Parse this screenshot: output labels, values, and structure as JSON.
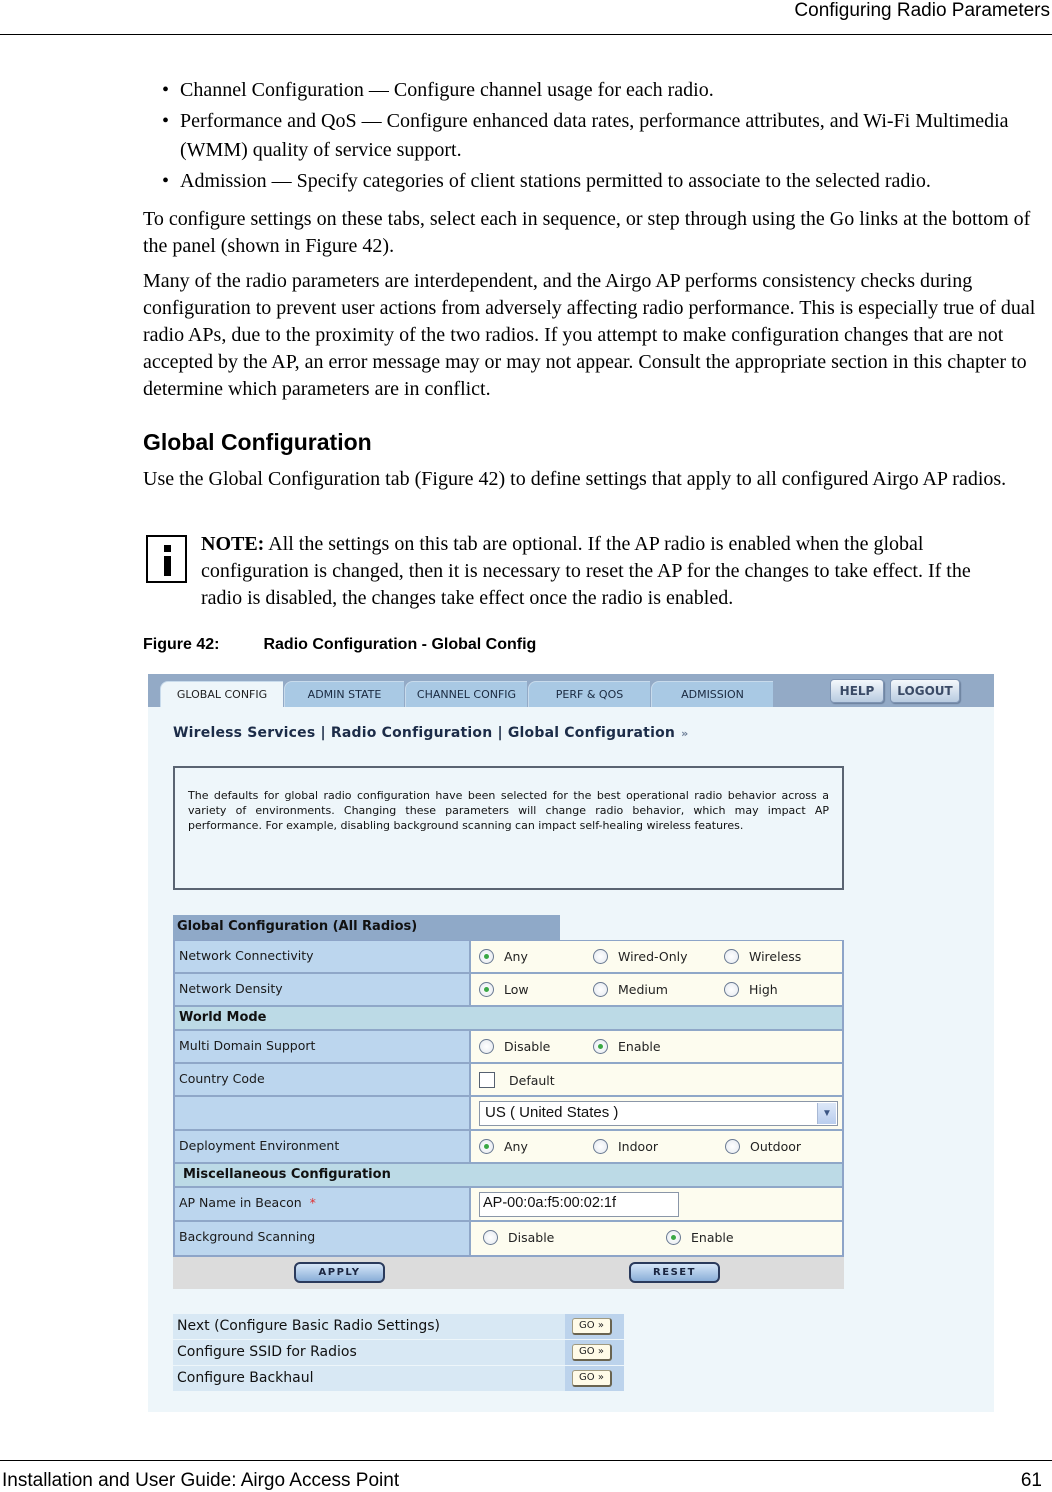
{
  "running_header": "Configuring Radio Parameters",
  "bullets": [
    "Channel Configuration — Configure channel usage for each radio.",
    "Performance and QoS — Configure enhanced data rates, performance attributes, and Wi-Fi Multimedia (WMM) quality of service support.",
    "Admission — Specify categories of client stations permitted to associate to the selected radio."
  ],
  "paragraphs": {
    "p1": "To configure settings on these tabs, select each in sequence, or step through using the Go links at the bottom of the panel (shown in Figure 42).",
    "p2": "Many of the radio parameters are interdependent, and the Airgo AP performs consistency checks during configuration to prevent user actions from adversely affecting radio performance. This is especially true of dual radio APs, due to the proximity of the two radios. If you attempt to make configuration changes that are not accepted by the AP, an error message may or may not appear. Consult the appropriate section in this chapter to determine which parameters are in conflict.",
    "section_heading": "Global Configuration",
    "p3": "Use the Global Configuration tab (Figure 42) to define settings that apply to all configured Airgo AP radios."
  },
  "note": {
    "icon": "info-icon",
    "label": "NOTE:",
    "text": " All the settings on this tab are optional. If the AP radio is enabled when the global configuration is changed, then it is necessary to reset the AP for the changes to take effect. If the radio is disabled, the changes take effect once the radio is enabled."
  },
  "figure": {
    "number": "Figure 42:",
    "title": "Radio Configuration - Global Config"
  },
  "ui": {
    "tabs": [
      {
        "label": "GLOBAL CONFIG",
        "active": true
      },
      {
        "label": "ADMIN STATE",
        "active": false
      },
      {
        "label": "CHANNEL CONFIG",
        "active": false
      },
      {
        "label": "PERF & QOS",
        "active": false
      },
      {
        "label": "ADMISSION",
        "active": false
      }
    ],
    "help_label": "HELP",
    "logout_label": "LOGOUT",
    "breadcrumb": "Wireless Services | Radio Configuration | Global Configuration",
    "breadcrumb_arrow": "»",
    "info_text": "The defaults for global radio configuration have been selected for the best operational radio behavior across a variety of environments. Changing these parameters will change radio behavior, which may impact AP performance. For example, disabling background scanning can impact self-healing wireless features.",
    "form_title": "Global Configuration (All Radios)",
    "network_connectivity": {
      "label": "Network Connectivity",
      "options": [
        "Any",
        "Wired-Only",
        "Wireless"
      ],
      "selected": "Any"
    },
    "network_density": {
      "label": "Network Density",
      "options": [
        "Low",
        "Medium",
        "High"
      ],
      "selected": "Low"
    },
    "world_mode_heading": "World Mode",
    "multi_domain": {
      "label": "Multi Domain Support",
      "options": [
        "Disable",
        "Enable"
      ],
      "selected": "Enable"
    },
    "country_code": {
      "label": "Country Code",
      "default_label": "Default",
      "default_checked": false,
      "selected_country": "US ( United States )"
    },
    "deployment_env": {
      "label": "Deployment Environment",
      "options": [
        "Any",
        "Indoor",
        "Outdoor"
      ],
      "selected": "Any"
    },
    "misc_heading": "Miscellaneous Configuration",
    "ap_name": {
      "label": "AP Name in Beacon",
      "required_mark": "*",
      "value": "AP-00:0a:f5:00:02:1f"
    },
    "background_scanning": {
      "label": "Background Scanning",
      "options": [
        "Disable",
        "Enable"
      ],
      "selected": "Enable"
    },
    "apply_label": "APPLY",
    "reset_label": "RESET",
    "nav_links": [
      {
        "label": "Next (Configure Basic Radio Settings)",
        "go": "GO »"
      },
      {
        "label": "Configure SSID for Radios",
        "go": "GO »"
      },
      {
        "label": "Configure Backhaul",
        "go": "GO »"
      }
    ]
  },
  "footer": {
    "left": "Installation and User Guide: Airgo Access Point",
    "page": "61"
  }
}
